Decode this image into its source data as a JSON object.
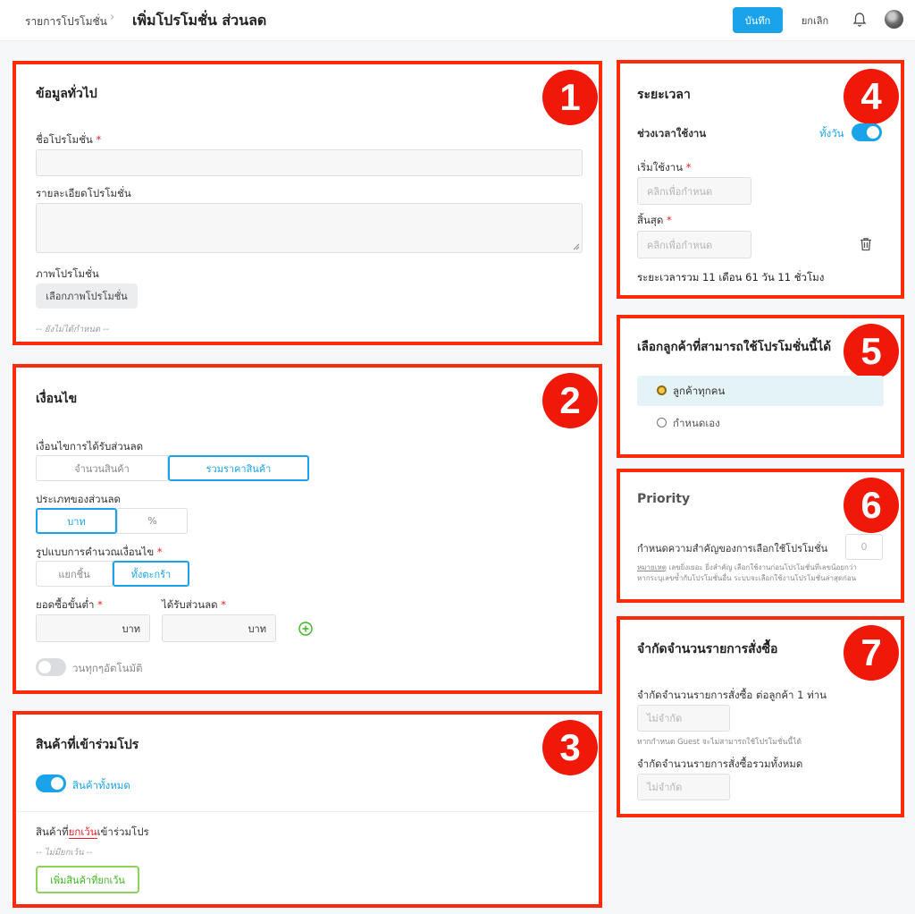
{
  "header": {
    "breadcrumb": "รายการโปรโมชั่น",
    "breadcrumb_sep": "›",
    "title": "เพิ่มโปรโมชั่น ส่วนลด",
    "save_label": "บันทึก",
    "cancel_label": "ยกเลิก"
  },
  "colors": {
    "accent": "#1aa3e8",
    "highlight": "#ff2a0a",
    "success": "#3cb521"
  },
  "general": {
    "number": "1",
    "title": "ข้อมูลทั่วไป",
    "name_label": "ชื่อโปรโมชั่น",
    "detail_label": "รายละเอียดโปรโมชั่น",
    "image_label": "ภาพโปรโมชั่น",
    "image_button": "เลือกภาพโปรโมชั่น",
    "not_set": "-- ยังไม่ได้กำหนด --"
  },
  "conditions": {
    "number": "2",
    "title": "เงื่อนไข",
    "cond_label": "เงื่อนไขการได้รับส่วนลด",
    "cond_options": [
      "จำนวนสินค้า",
      "รวมราคาสินค้า"
    ],
    "type_label": "ประเภทของส่วนลด",
    "type_options": [
      "บาท",
      "%"
    ],
    "calc_label": "รูปแบบการคำนวณเงื่อนไข",
    "calc_options": [
      "แยกชิ้น",
      "ทั้งตะกร้า"
    ],
    "min_label": "ยอดซื้อขั้นต่ำ",
    "min_unit": "บาท",
    "discount_label": "ได้รับส่วนลด",
    "discount_unit": "บาท",
    "loop_label": "วนทุกๆอัตโนมัติ"
  },
  "products": {
    "number": "3",
    "title": "สินค้าที่เข้าร่วมโปร",
    "all_label": "สินค้าทั้งหมด",
    "except_prefix": "สินค้าที่",
    "except_word": "ยกเว้น",
    "except_suffix": "เข้าร่วมโปร",
    "none_text": "-- ไม่มียกเว้น --",
    "add_button": "เพิ่มสินค้าที่ยกเว้น"
  },
  "period": {
    "number": "4",
    "title": "ระยะเวลา",
    "range_label": "ช่วงเวลาใช้งาน",
    "allday_label": "ทั้งวัน",
    "start_label": "เริ่มใช้งาน",
    "start_placeholder": "คลิกเพื่อกำหนด",
    "end_label": "สิ้นสุด",
    "end_placeholder": "คลิกเพื่อกำหนด",
    "total_text": "ระยะเวลารวม 11 เดือน 61 วัน 11 ชั่วโมง"
  },
  "customers": {
    "number": "5",
    "title": "เลือกลูกค้าที่สามารถใช้โปรโมชั่นนี้ได้",
    "options": [
      "ลูกค้าทุกคน",
      "กำหนดเอง"
    ]
  },
  "priority": {
    "number": "6",
    "title": "Priority",
    "label": "กำหนดความสำคัญของการเลือกใช้โปรโมชั่น",
    "value": "0",
    "note_word": "หมายเหตุ",
    "note_line1": " เลขยิ่งเยอะ ยิ่งสำคัญ เลือกใช้งานก่อนโปรโมชั่นที่เลขน้อยกว่า",
    "note_line2": "หากระบุเลขซ้ำกับโปรโมชั่นอื่น ระบบจะเลือกใช้งานโปรโมชั่นล่าสุดก่อน"
  },
  "limits": {
    "number": "7",
    "title": "จำกัดจำนวนรายการสั่งซื้อ",
    "per_customer_label": "จำกัดจำนวนรายการสั่งซื้อ ต่อลูกค้า 1 ท่าน",
    "per_customer_placeholder": "ไม่จำกัด",
    "guest_note": "หากกำหนด Guest จะไม่สามารถใช้โปรโมชั่นนี้ได้",
    "total_label": "จำกัดจำนวนรายการสั่งซื้อรวมทั้งหมด",
    "total_placeholder": "ไม่จำกัด"
  }
}
